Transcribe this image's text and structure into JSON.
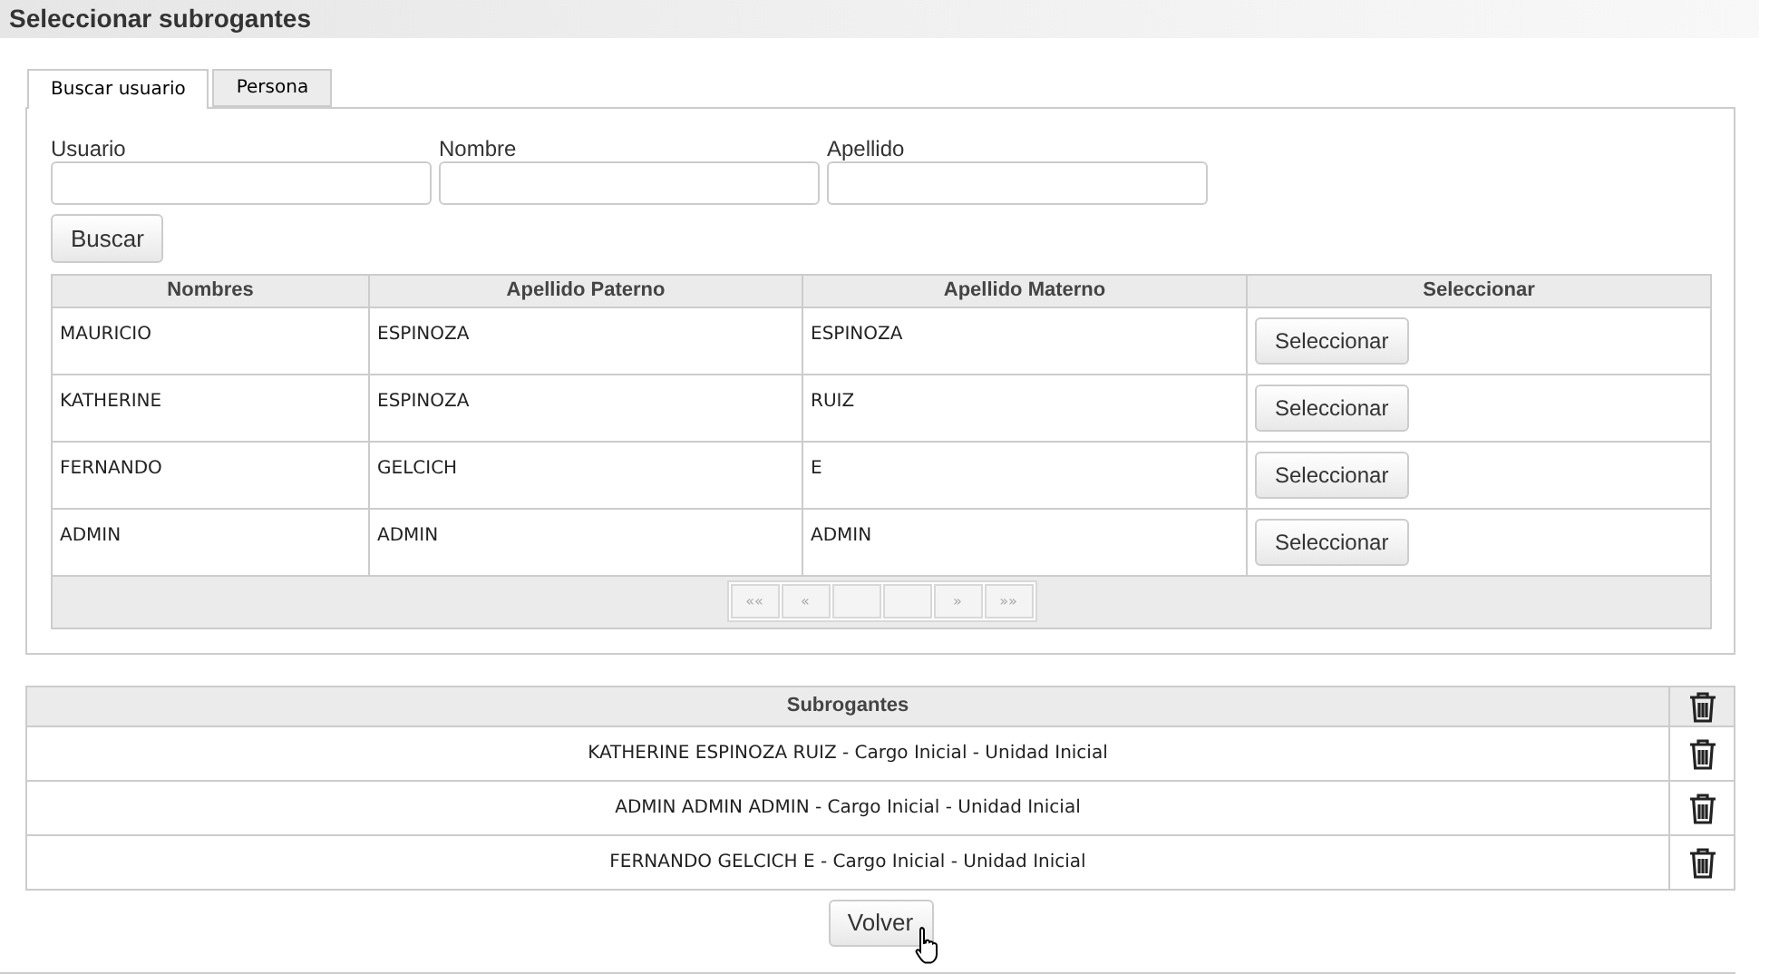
{
  "title": "Seleccionar subrogantes",
  "tabs": [
    {
      "label": "Buscar usuario",
      "selected": true
    },
    {
      "label": "Persona",
      "selected": false
    }
  ],
  "search_fields": [
    {
      "label": "Usuario"
    },
    {
      "label": "Nombre"
    },
    {
      "label": "Apellido"
    }
  ],
  "search_button": "Buscar",
  "results": {
    "columns": [
      "Nombres",
      "Apellido Paterno",
      "Apellido Materno",
      "Seleccionar"
    ],
    "rows": [
      {
        "cells": [
          "MAURICIO",
          "ESPINOZA",
          "ESPINOZA"
        ],
        "button": "Seleccionar"
      },
      {
        "cells": [
          "KATHERINE",
          "ESPINOZA",
          "RUIZ"
        ],
        "button": "Seleccionar"
      },
      {
        "cells": [
          "FERNANDO",
          "GELCICH",
          "E"
        ],
        "button": "Seleccionar"
      },
      {
        "cells": [
          "ADMIN",
          "ADMIN",
          "ADMIN"
        ],
        "button": "Seleccionar"
      }
    ],
    "pager": [
      {
        "kind": "arrow",
        "label": "««"
      },
      {
        "kind": "arrow",
        "label": "«"
      },
      {
        "kind": "blank"
      },
      {
        "kind": "blank"
      },
      {
        "kind": "arrow",
        "label": "»"
      },
      {
        "kind": "arrow",
        "label": "»»"
      }
    ]
  },
  "subrogantes": {
    "heading": "Subrogantes",
    "rows": [
      "KATHERINE ESPINOZA RUIZ - Cargo Inicial - Unidad Inicial",
      "ADMIN ADMIN ADMIN - Cargo Inicial - Unidad Inicial",
      "FERNANDO GELCICH E - Cargo Inicial - Unidad Inicial"
    ]
  },
  "back_button": "Volver"
}
